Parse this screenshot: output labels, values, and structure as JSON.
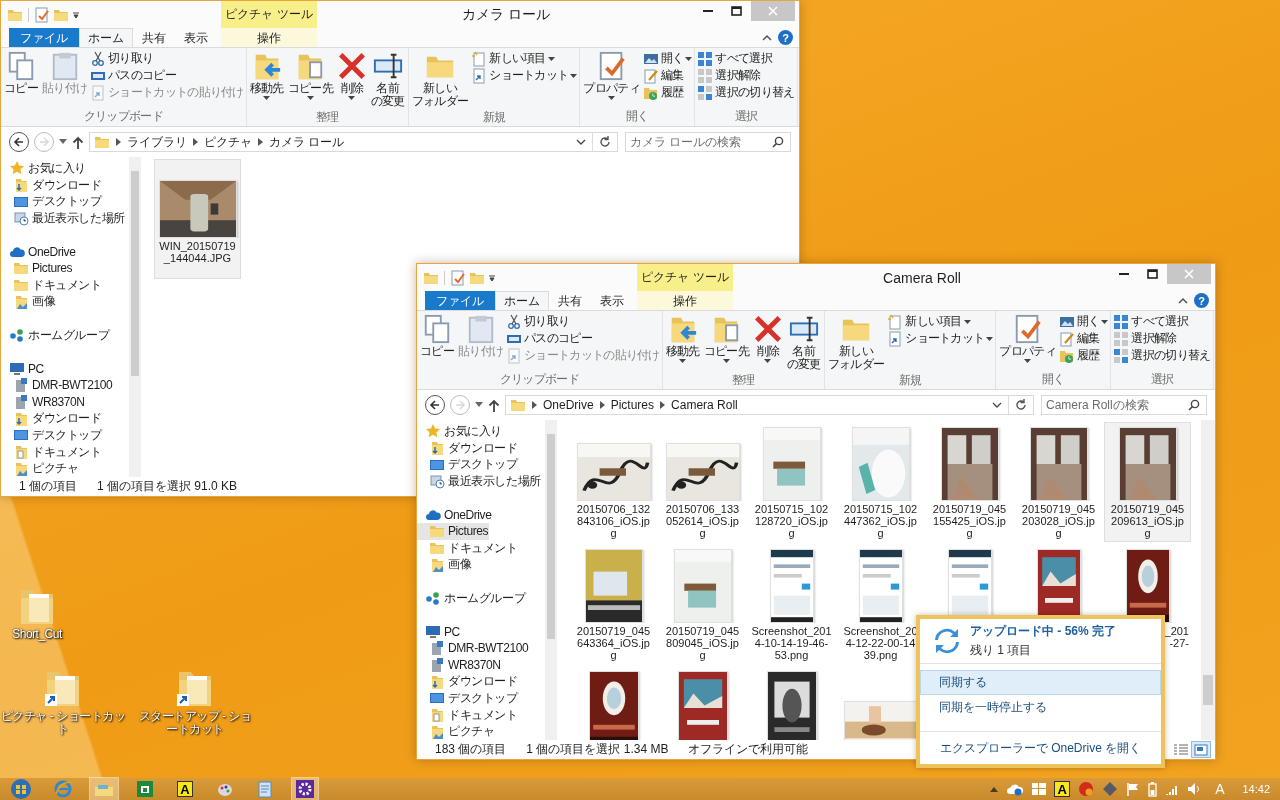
{
  "desktop_icons": [
    {
      "lines": [
        "Short_Cut"
      ],
      "shortcut": false
    },
    {
      "lines": [
        "ピクチャ - ショートカッ",
        "ト"
      ],
      "shortcut": true
    },
    {
      "lines": [
        "スタートアップ - ショ",
        "ートカット"
      ],
      "shortcut": true
    }
  ],
  "windows": [
    {
      "title": "カメラ ロール",
      "tool_tab_group": "ピクチャ ツール",
      "help": "?",
      "tabs": [
        {
          "label": "ファイル",
          "kind": "file",
          "selected": false
        },
        {
          "label": "ホーム",
          "kind": "tab",
          "selected": true
        },
        {
          "label": "共有",
          "kind": "tab",
          "selected": false
        },
        {
          "label": "表示",
          "kind": "tab",
          "selected": false
        },
        {
          "label": "操作",
          "kind": "tool",
          "selected": false
        }
      ],
      "ribbon": [
        {
          "label": "クリップボード",
          "commands": [
            {
              "lines": [
                "コピー"
              ],
              "kind": "large",
              "disabled": false,
              "dropdown": false
            },
            {
              "lines": [
                "貼り付け"
              ],
              "kind": "large",
              "disabled": true,
              "dropdown": false
            },
            {
              "label": "切り取り",
              "kind": "small",
              "disabled": false,
              "dropdown": false
            },
            {
              "label": "パスのコピー",
              "kind": "small",
              "disabled": false,
              "dropdown": false
            },
            {
              "label": "ショートカットの貼り付け",
              "kind": "small",
              "disabled": true,
              "dropdown": false
            }
          ]
        },
        {
          "label": "整理",
          "commands": [
            {
              "lines": [
                "移動先"
              ],
              "kind": "large",
              "disabled": false,
              "dropdown": true
            },
            {
              "lines": [
                "コピー先"
              ],
              "kind": "large",
              "disabled": false,
              "dropdown": true
            },
            {
              "lines": [
                "削除"
              ],
              "kind": "large",
              "disabled": false,
              "dropdown": true
            },
            {
              "lines": [
                "名前",
                "の変更"
              ],
              "kind": "large",
              "disabled": false,
              "dropdown": false
            }
          ]
        },
        {
          "label": "新規",
          "commands": [
            {
              "lines": [
                "新しい",
                "フォルダー"
              ],
              "kind": "large",
              "disabled": false,
              "dropdown": false
            },
            {
              "label": "新しい項目",
              "kind": "small",
              "disabled": false,
              "dropdown": true
            },
            {
              "label": "ショートカット",
              "kind": "small",
              "disabled": false,
              "dropdown": true
            }
          ]
        },
        {
          "label": "開く",
          "commands": [
            {
              "lines": [
                "プロパティ"
              ],
              "kind": "large",
              "disabled": false,
              "dropdown": true
            },
            {
              "label": "開く",
              "kind": "small",
              "disabled": false,
              "dropdown": true
            },
            {
              "label": "編集",
              "kind": "small",
              "disabled": false,
              "dropdown": false
            },
            {
              "label": "履歴",
              "kind": "small",
              "disabled": false,
              "dropdown": false
            }
          ]
        },
        {
          "label": "選択",
          "commands": [
            {
              "label": "すべて選択",
              "kind": "small",
              "disabled": false,
              "dropdown": false
            },
            {
              "label": "選択解除",
              "kind": "small",
              "disabled": false,
              "dropdown": false
            },
            {
              "label": "選択の切り替え",
              "kind": "small",
              "disabled": false,
              "dropdown": false
            }
          ]
        }
      ],
      "nav_buttons": [
        {
          "kind": "back",
          "disabled": false
        },
        {
          "kind": "forward",
          "disabled": true
        }
      ],
      "address": [
        "ライブラリ",
        "ピクチャ",
        "カメラ ロール"
      ],
      "search_placeholder": "カメラ ロールの検索",
      "nav": [
        {
          "label": "お気に入り",
          "kind": "star",
          "selected": false,
          "children": [
            {
              "label": "ダウンロード",
              "kind": "download",
              "selected": false
            },
            {
              "label": "デスクトップ",
              "kind": "desktop",
              "selected": false
            },
            {
              "label": "最近表示した場所",
              "kind": "recent",
              "selected": false
            }
          ]
        },
        {
          "label": "OneDrive",
          "kind": "cloud",
          "selected": false,
          "children": [
            {
              "label": "Pictures",
              "kind": "folder",
              "selected": false
            },
            {
              "label": "ドキュメント",
              "kind": "folder",
              "selected": false
            },
            {
              "label": "画像",
              "kind": "pictures",
              "selected": false
            }
          ]
        },
        {
          "label": "ホームグループ",
          "kind": "homegroup",
          "selected": false
        },
        {
          "label": "PC",
          "kind": "pc",
          "selected": false,
          "children": [
            {
              "label": "DMR-BWT2100",
              "kind": "device",
              "selected": false
            },
            {
              "label": "WR8370N",
              "kind": "device",
              "selected": false
            },
            {
              "label": "ダウンロード",
              "kind": "download",
              "selected": false
            },
            {
              "label": "デスクトップ",
              "kind": "desktop",
              "selected": false
            },
            {
              "label": "ドキュメント",
              "kind": "documents",
              "selected": false
            },
            {
              "label": "ピクチャ",
              "kind": "pictures",
              "selected": false
            }
          ]
        }
      ],
      "files": [
        {
          "lines": [
            "WIN_20150719",
            "_144044.JPG"
          ],
          "selected": true
        }
      ],
      "status": {
        "count": "1 個の項目",
        "selection": "1 個の項目を選択 91.0 KB"
      }
    },
    {
      "title": "Camera Roll",
      "tool_tab_group": "ピクチャ ツール",
      "help": "?",
      "tabs": [
        {
          "label": "ファイル",
          "kind": "file",
          "selected": false
        },
        {
          "label": "ホーム",
          "kind": "tab",
          "selected": true
        },
        {
          "label": "共有",
          "kind": "tab",
          "selected": false
        },
        {
          "label": "表示",
          "kind": "tab",
          "selected": false
        },
        {
          "label": "操作",
          "kind": "tool",
          "selected": false
        }
      ],
      "ribbon": [
        {
          "label": "クリップボード",
          "commands": [
            {
              "lines": [
                "コピー"
              ],
              "kind": "large",
              "disabled": false,
              "dropdown": false
            },
            {
              "lines": [
                "貼り付け"
              ],
              "kind": "large",
              "disabled": true,
              "dropdown": false
            },
            {
              "label": "切り取り",
              "kind": "small",
              "disabled": false,
              "dropdown": false
            },
            {
              "label": "パスのコピー",
              "kind": "small",
              "disabled": false,
              "dropdown": false
            },
            {
              "label": "ショートカットの貼り付け",
              "kind": "small",
              "disabled": true,
              "dropdown": false
            }
          ]
        },
        {
          "label": "整理",
          "commands": [
            {
              "lines": [
                "移動先"
              ],
              "kind": "large",
              "disabled": false,
              "dropdown": true
            },
            {
              "lines": [
                "コピー先"
              ],
              "kind": "large",
              "disabled": false,
              "dropdown": true
            },
            {
              "lines": [
                "削除"
              ],
              "kind": "large",
              "disabled": false,
              "dropdown": true
            },
            {
              "lines": [
                "名前",
                "の変更"
              ],
              "kind": "large",
              "disabled": false,
              "dropdown": false
            }
          ]
        },
        {
          "label": "新規",
          "commands": [
            {
              "lines": [
                "新しい",
                "フォルダー"
              ],
              "kind": "large",
              "disabled": false,
              "dropdown": false
            },
            {
              "label": "新しい項目",
              "kind": "small",
              "disabled": false,
              "dropdown": true
            },
            {
              "label": "ショートカット",
              "kind": "small",
              "disabled": false,
              "dropdown": true
            }
          ]
        },
        {
          "label": "開く",
          "commands": [
            {
              "lines": [
                "プロパティ"
              ],
              "kind": "large",
              "disabled": false,
              "dropdown": true
            },
            {
              "label": "開く",
              "kind": "small",
              "disabled": false,
              "dropdown": true
            },
            {
              "label": "編集",
              "kind": "small",
              "disabled": false,
              "dropdown": false
            },
            {
              "label": "履歴",
              "kind": "small",
              "disabled": false,
              "dropdown": false
            }
          ]
        },
        {
          "label": "選択",
          "commands": [
            {
              "label": "すべて選択",
              "kind": "small",
              "disabled": false,
              "dropdown": false
            },
            {
              "label": "選択解除",
              "kind": "small",
              "disabled": false,
              "dropdown": false
            },
            {
              "label": "選択の切り替え",
              "kind": "small",
              "disabled": false,
              "dropdown": false
            }
          ]
        }
      ],
      "nav_buttons": [
        {
          "kind": "back",
          "disabled": false
        },
        {
          "kind": "forward",
          "disabled": true
        }
      ],
      "address": [
        "OneDrive",
        "Pictures",
        "Camera Roll"
      ],
      "search_placeholder": "Camera Rollの検索",
      "nav": [
        {
          "label": "お気に入り",
          "kind": "star",
          "selected": false,
          "children": [
            {
              "label": "ダウンロード",
              "kind": "download",
              "selected": false
            },
            {
              "label": "デスクトップ",
              "kind": "desktop",
              "selected": false
            },
            {
              "label": "最近表示した場所",
              "kind": "recent",
              "selected": false
            }
          ]
        },
        {
          "label": "OneDrive",
          "kind": "cloud",
          "selected": false,
          "children": [
            {
              "label": "Pictures",
              "kind": "folder",
              "selected": true
            },
            {
              "label": "ドキュメント",
              "kind": "folder",
              "selected": false
            },
            {
              "label": "画像",
              "kind": "pictures",
              "selected": false
            }
          ]
        },
        {
          "label": "ホームグループ",
          "kind": "homegroup",
          "selected": false
        },
        {
          "label": "PC",
          "kind": "pc",
          "selected": false,
          "children": [
            {
              "label": "DMR-BWT2100",
              "kind": "device",
              "selected": false
            },
            {
              "label": "WR8370N",
              "kind": "device",
              "selected": false
            },
            {
              "label": "ダウンロード",
              "kind": "download",
              "selected": false
            },
            {
              "label": "デスクトップ",
              "kind": "desktop",
              "selected": false
            },
            {
              "label": "ドキュメント",
              "kind": "documents",
              "selected": false
            },
            {
              "label": "ピクチャ",
              "kind": "pictures",
              "selected": false
            }
          ]
        }
      ],
      "files": [
        {
          "lines": [
            "20150706_132",
            "843106_iOS.jp",
            "g"
          ],
          "selected": false
        },
        {
          "lines": [
            "20150706_133",
            "052614_iOS.jp",
            "g"
          ],
          "selected": false
        },
        {
          "lines": [
            "20150715_102",
            "128720_iOS.jp",
            "g"
          ],
          "selected": false
        },
        {
          "lines": [
            "20150715_102",
            "447362_iOS.jp",
            "g"
          ],
          "selected": false
        },
        {
          "lines": [
            "20150719_045",
            "155425_iOS.jp",
            "g"
          ],
          "selected": false
        },
        {
          "lines": [
            "20150719_045",
            "203028_iOS.jp",
            "g"
          ],
          "selected": false
        },
        {
          "lines": [
            "20150719_045",
            "209613_iOS.jp",
            "g"
          ],
          "selected": true
        },
        {
          "lines": [
            "20150719_045",
            "643364_iOS.jp",
            "g"
          ],
          "selected": false
        },
        {
          "lines": [
            "20150719_045",
            "809045_iOS.jp",
            "g"
          ],
          "selected": false
        },
        {
          "lines": [
            "Screenshot_201",
            "4-10-14-19-46-",
            "53.png"
          ],
          "selected": false
        },
        {
          "lines": [
            "Screenshot_20",
            "4-12-22-00-14",
            "39.png"
          ],
          "selected": false
        },
        {
          "selected": false
        },
        {
          "selected": false
        },
        {
          "lines": [
            "_201",
            "-27-"
          ],
          "partly_covered": true,
          "selected": false
        },
        {
          "selected": false
        },
        {
          "selected": false
        },
        {
          "selected": false
        },
        {
          "selected": false
        }
      ],
      "status": {
        "count": "183 個の項目",
        "selection": "1 個の項目を選択 1.34 MB",
        "availability": "オフラインで利用可能"
      },
      "view_modes": [
        {
          "kind": "details",
          "selected": false
        },
        {
          "kind": "large-icons",
          "selected": true
        }
      ]
    }
  ],
  "onedrive_popup": {
    "title": "アップロード中 - 56% 完了",
    "subtitle": "残り 1 項目",
    "items": [
      {
        "label": "同期する",
        "selected": true
      },
      {
        "label": "同期を一時停止する",
        "selected": false
      }
    ],
    "link": "エクスプローラーで OneDrive を開く"
  },
  "taskbar": {
    "apps": [
      {
        "kind": "ie",
        "active": false
      },
      {
        "kind": "explorer",
        "active": true
      },
      {
        "kind": "store",
        "active": false
      },
      {
        "kind": "atok",
        "label": "A",
        "active": false
      },
      {
        "kind": "paint",
        "active": false
      },
      {
        "kind": "notepad",
        "active": false
      },
      {
        "kind": "settings",
        "active": true
      }
    ],
    "tray": [
      {
        "kind": "arrow"
      },
      {
        "kind": "onedrive"
      },
      {
        "kind": "windows"
      },
      {
        "kind": "atok",
        "label": "A"
      },
      {
        "kind": "red"
      },
      {
        "kind": "diamond"
      },
      {
        "kind": "flag"
      },
      {
        "kind": "battery"
      },
      {
        "kind": "signal"
      },
      {
        "kind": "speaker"
      }
    ],
    "ime_mode": "A",
    "clock": "14:42"
  }
}
